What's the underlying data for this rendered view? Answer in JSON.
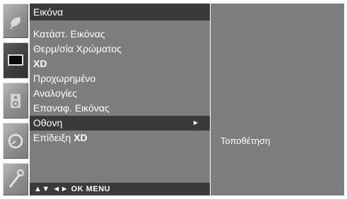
{
  "menu": {
    "title": "Εικόνα",
    "items": [
      {
        "text": "Κατάστ. Εικόνας",
        "bold": ""
      },
      {
        "text": "Θερμ/σία Χρώματος",
        "bold": ""
      },
      {
        "text": "",
        "bold": "XD"
      },
      {
        "text": "Προχωρημένο",
        "bold": ""
      },
      {
        "text": "Αναλογίες",
        "bold": ""
      },
      {
        "text": "Επαναφ. Εικόνας",
        "bold": ""
      },
      {
        "text": "Οθονη",
        "bold": "",
        "arrow": "►"
      },
      {
        "text": "Επίδειξη ",
        "bold": "XD"
      }
    ],
    "selected_index": 6,
    "footer": "▲▼  ◄►  OK  MENU"
  },
  "submenu": {
    "items": [
      "Τοποθέτηση"
    ]
  },
  "sidebar": {
    "icons": [
      "satellite-dish-icon",
      "picture-icon",
      "audio-speaker-icon",
      "clock-icon",
      "option-wrench-icon"
    ],
    "selected_index": 1
  },
  "colors": {
    "panel": "#7d7d7d",
    "highlight": "#3a3a3a",
    "text": "#ffffff"
  }
}
